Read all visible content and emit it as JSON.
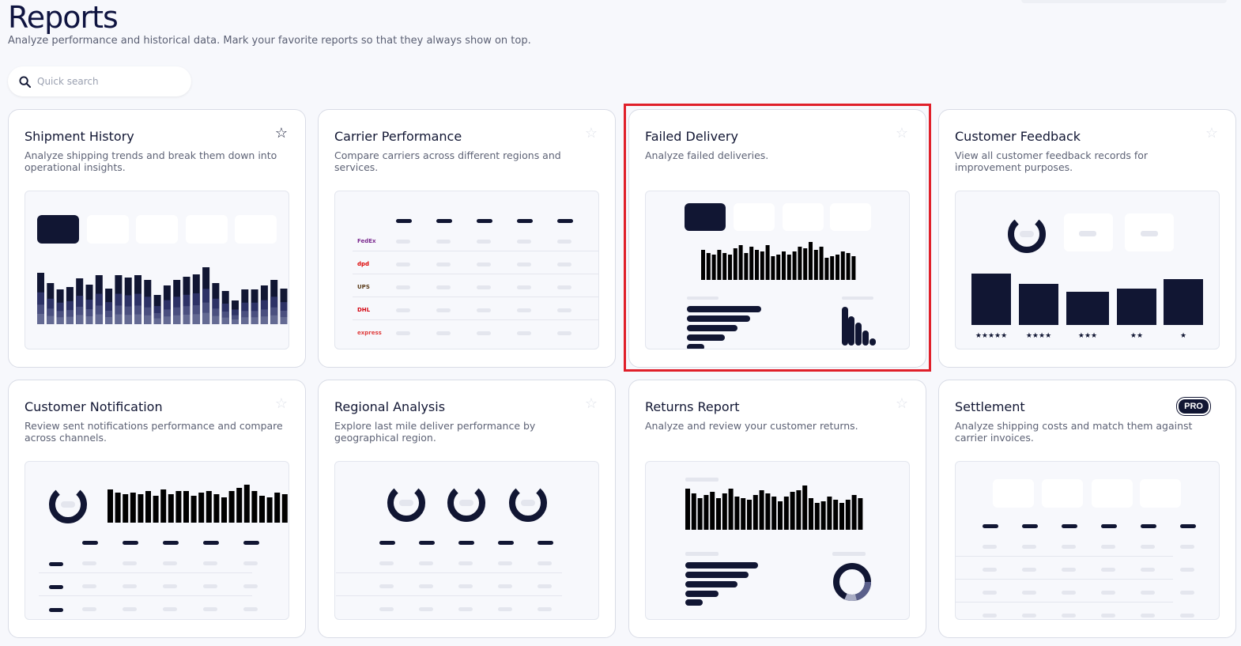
{
  "header": {
    "title": "Reports",
    "subtitle": "Analyze performance and historical data. Mark your favorite reports so that they always show on top."
  },
  "search": {
    "placeholder": "Quick search",
    "icon": "search-icon"
  },
  "colors": {
    "navy": "#111633",
    "highlight": "#e0202a"
  },
  "cards": [
    {
      "title": "Shipment History",
      "desc": "Analyze shipping trends and break them down into operational insights.",
      "favorite": true
    },
    {
      "title": "Carrier Performance",
      "desc": "Compare carriers across different regions and services.",
      "favorite": false,
      "carriers": [
        "FedEx",
        "dpd",
        "UPS",
        "DHL",
        "express"
      ]
    },
    {
      "title": "Failed Delivery",
      "desc": "Analyze failed deliveries.",
      "favorite": false,
      "highlighted": true
    },
    {
      "title": "Customer Feedback",
      "desc": "View all customer feedback records for improvement purposes.",
      "favorite": false,
      "ratings": [
        "★★★★★",
        "★★★★",
        "★★★",
        "★★",
        "★"
      ]
    },
    {
      "title": "Customer Notification",
      "desc": "Review sent notifications performance and compare across channels.",
      "favorite": false
    },
    {
      "title": "Regional Analysis",
      "desc": "Explore last mile deliver performance by geographical region.",
      "favorite": false
    },
    {
      "title": "Returns Report",
      "desc": "Analyze and review your customer returns.",
      "favorite": false
    },
    {
      "title": "Settlement",
      "desc": "Analyze shipping costs and match them against carrier invoices.",
      "favorite": false,
      "badge": "PRO"
    }
  ]
}
